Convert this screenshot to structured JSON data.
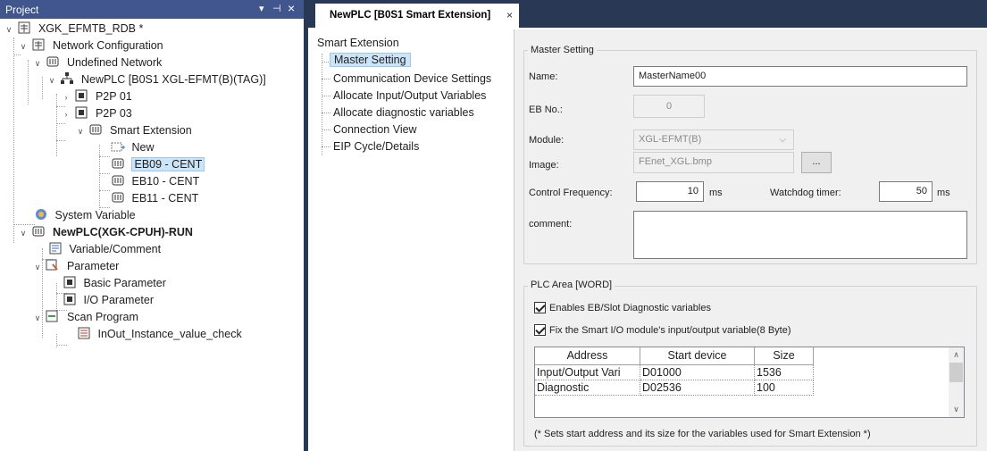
{
  "project_panel": {
    "title": "Project",
    "buttons": {
      "dropdown": "▾",
      "pin": "⊣",
      "close": "×"
    },
    "tree": {
      "root": "XGK_EFMTB_RDB *",
      "network_configuration": "Network Configuration",
      "undefined_network": "Undefined Network",
      "newplc_network": "NewPLC [B0S1 XGL-EFMT(B)(TAG)]",
      "p2p_01": "P2P 01",
      "p2p_03": "P2P 03",
      "smart_extension": "Smart Extension",
      "new": "New",
      "eb09": "EB09 - CENT",
      "eb10": "EB10 - CENT",
      "eb11": "EB11 - CENT",
      "system_variable": "System Variable",
      "newplc_cpu": "NewPLC(XGK-CPUH)-RUN",
      "variable_comment": "Variable/Comment",
      "parameter": "Parameter",
      "basic_parameter": "Basic Parameter",
      "io_parameter": "I/O Parameter",
      "scan_program": "Scan Program",
      "inout_check": "InOut_Instance_value_check"
    }
  },
  "document": {
    "tab_label": "NewPLC [B0S1 Smart Extension]",
    "tab_close": "×",
    "nav": {
      "root": "Smart Extension",
      "items": [
        "Master Setting",
        "Communication Device Settings",
        "Allocate Input/Output Variables",
        "Allocate diagnostic variables",
        "Connection View",
        "EIP Cycle/Details"
      ]
    },
    "master_setting": {
      "group_title": "Master Setting",
      "name_label": "Name:",
      "name_value": "MasterName00",
      "eb_label": "EB No.:",
      "eb_value": "0",
      "module_label": "Module:",
      "module_value": "XGL-EFMT(B)",
      "image_label": "Image:",
      "image_value": "FEnet_XGL.bmp",
      "browse_label": "...",
      "freq_label": "Control Frequency:",
      "freq_value": "10",
      "freq_unit": "ms",
      "watchdog_label": "Watchdog timer:",
      "watchdog_value": "50",
      "watchdog_unit": "ms",
      "comment_label": "comment:",
      "comment_value": ""
    },
    "plc_area": {
      "group_title": "PLC Area [WORD]",
      "chk_enable_label": "Enables EB/Slot Diagnostic variables",
      "chk_fix_label": "Fix the Smart I/O module's input/output variable(8 Byte)",
      "columns": [
        "Address",
        "Start device",
        "Size"
      ],
      "rows": [
        [
          "Input/Output Vari",
          "D01000",
          "1536"
        ],
        [
          "Diagnostic",
          "D02536",
          "100"
        ]
      ],
      "note": "(* Sets start address and its size for the variables used for Smart Extension *)"
    }
  }
}
